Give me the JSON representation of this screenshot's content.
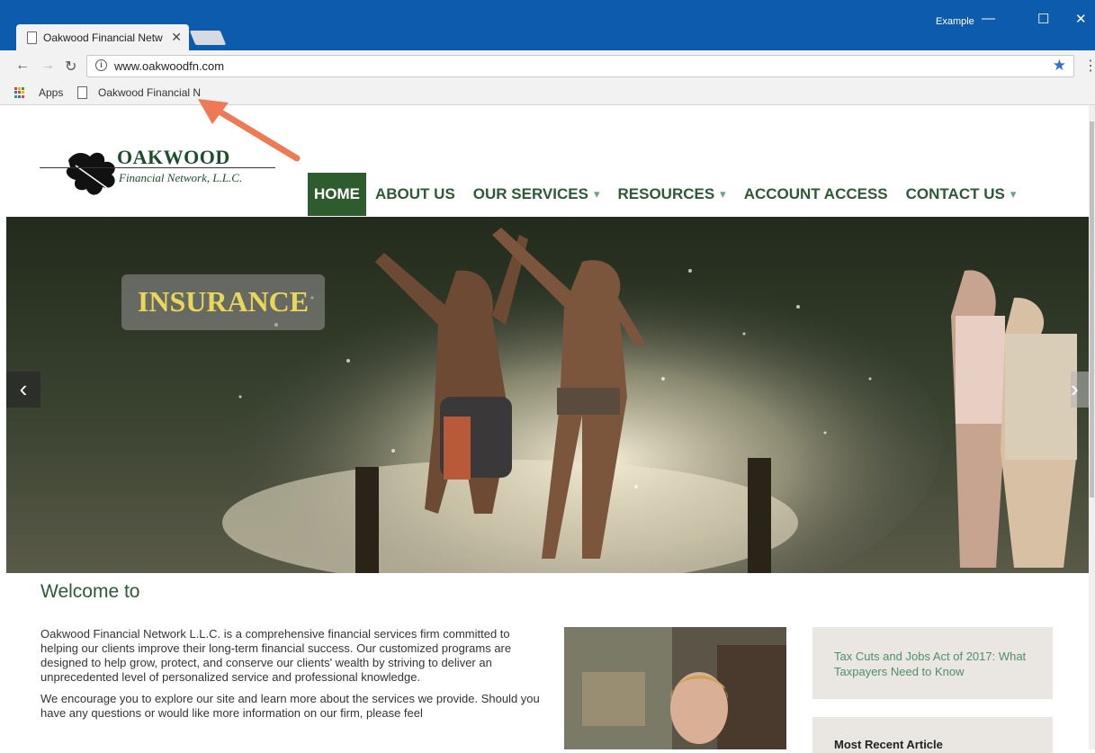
{
  "browser": {
    "tab_title": "Oakwood Financial Netw",
    "profile_name": "Example",
    "url": "www.oakwoodfn.com",
    "bookmarks": {
      "apps_label": "Apps",
      "item_label": "Oakwood Financial N"
    }
  },
  "logo": {
    "name": "OAKWOOD",
    "tagline": "Financial Network, L.L.C."
  },
  "nav": {
    "home": "HOME",
    "about": "ABOUT US",
    "services": "OUR SERVICES",
    "resources": "RESOURCES",
    "account": "ACCOUNT ACCESS",
    "contact": "CONTACT US"
  },
  "hero": {
    "label": "INSURANCE"
  },
  "welcome": {
    "heading": "Welcome to",
    "para1": "Oakwood Financial Network L.L.C. is a comprehensive financial services firm committed to helping our clients improve their long-term financial success. Our customized programs are designed to help grow, protect, and conserve our clients' wealth by striving to deliver an unprecedented level of personalized service and professional knowledge.",
    "para2": "We encourage you to explore our site and learn more about the services we provide. Should you have any questions or would like more information on our firm, please feel"
  },
  "sidebar": {
    "article_link": "Tax Cuts and Jobs Act of 2017: What Taxpayers Need to Know",
    "recent_heading": "Most Recent Article"
  },
  "colors": {
    "brand_green": "#2d5a34",
    "chrome_blue": "#0c5bad",
    "link_green": "#4e8f66"
  }
}
